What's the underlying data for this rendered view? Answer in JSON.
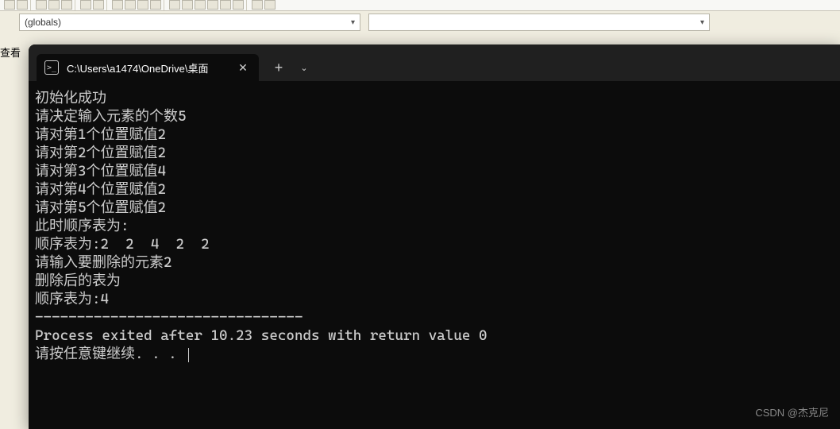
{
  "editor": {
    "dropdown1": "(globals)",
    "dropdown2": "",
    "left_panel_text": "查看"
  },
  "terminal": {
    "tab": {
      "icon_glyph": ">_",
      "title": "C:\\Users\\a1474\\OneDrive\\桌面"
    },
    "output": {
      "lines": [
        "初始化成功",
        "请决定输入元素的个数5",
        "请对第1个位置赋值2",
        "请对第2个位置赋值2",
        "请对第3个位置赋值4",
        "请对第4个位置赋值2",
        "请对第5个位置赋值2",
        "此时顺序表为:",
        "顺序表为:2  2  4  2  2",
        "请输入要删除的元素2",
        "删除后的表为",
        "顺序表为:4",
        "--------------------------------",
        "Process exited after 10.23 seconds with return value 0",
        "请按任意键继续. . . "
      ]
    }
  },
  "watermark": "CSDN @杰克尼"
}
